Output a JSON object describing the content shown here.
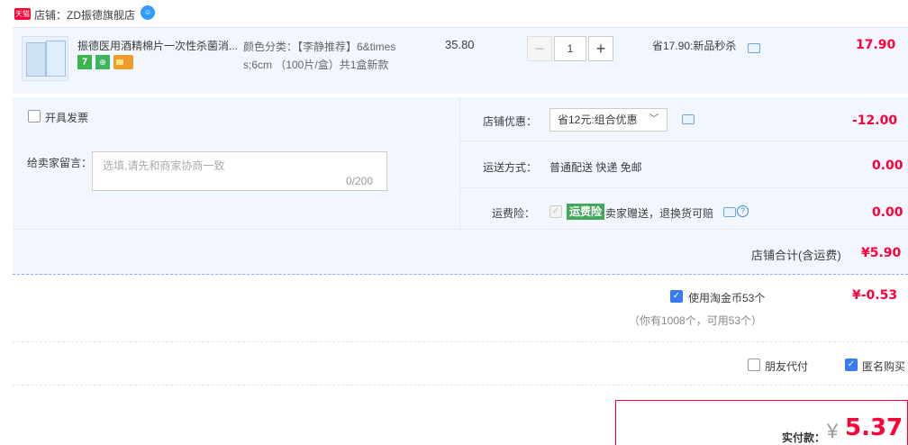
{
  "shop": {
    "badge": "天猫",
    "label": "店铺：ZD振德旗舰店"
  },
  "item": {
    "title": "振德医用酒精棉片一次性杀菌消...",
    "sku_line1": "颜色分类：【李静推荐】6&times",
    "sku_line2": "s;6cm （100片/盒）共1盒新款",
    "unit_price": "35.80",
    "quantity": "1",
    "qty_minus": "−",
    "qty_plus": "+",
    "promo": "省17.90:新品秒杀",
    "total": "17.90",
    "badge_7": "7",
    "badge_shield": "⊕"
  },
  "invoice": {
    "label": "开具发票"
  },
  "memo": {
    "label": "给卖家留言：",
    "placeholder": "选填,请先和商家协商一致",
    "count": "0/200"
  },
  "coupon": {
    "label": "店铺优惠：",
    "selected": "省12元:组合优惠",
    "amount": "-12.00"
  },
  "shipping": {
    "label": "运送方式：",
    "value": "普通配送 快递 免邮",
    "amount": "0.00"
  },
  "insurance": {
    "label": "运费险：",
    "badge": "运费险",
    "text": "卖家赠送，退换货可赔",
    "amount": "0.00",
    "help": "?"
  },
  "subtotal": {
    "label": "店铺合计(含运费)",
    "amount": "¥5.90"
  },
  "coins": {
    "label": "使用淘金币53个",
    "amount": "¥-0.53",
    "note": "（你有1008个，可用53个）"
  },
  "options": {
    "friend_pay": "朋友代付",
    "anonymous": "匿名购买"
  },
  "payment": {
    "label": "实付款：",
    "currency": "¥",
    "amount": "5.37"
  },
  "colors": {
    "accent_red": "#ff0036",
    "row_bg": "#f2f7ff",
    "check_blue": "#3a7af2"
  }
}
